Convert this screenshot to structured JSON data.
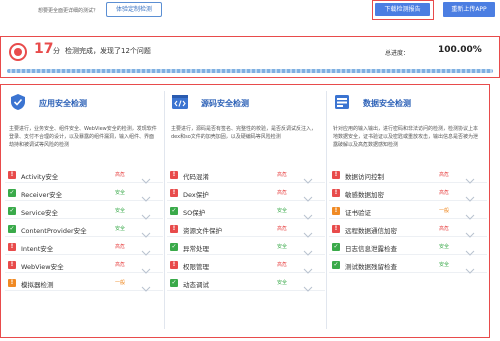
{
  "top": {
    "hint": "想要更全面更详细的测试？",
    "custom_btn": "体验定制检测",
    "download_btn": "下载检测报告",
    "reupload_btn": "重新上传APP"
  },
  "summary": {
    "score": "17",
    "score_unit": "分",
    "status": "检测完成，发现了12个问题",
    "progress_label": "总进度：",
    "progress_value": "100.00%",
    "progress_fraction": 1.0
  },
  "colors": {
    "accent": "#4b7ee2",
    "danger": "#e84b4b",
    "ok": "#3aaa4a",
    "warn": "#f08a24",
    "title": "#2f63b8"
  },
  "columns": [
    {
      "title": "应用安全检测",
      "icon": "shield-check-icon",
      "desc": "主要进行，业务安全、组件安全、WebView安全的检测，发现软件登录、支付不合理的设计，以及暴露的组件漏洞，输入组件、界面劫持和被调试等风险的检测",
      "items": [
        {
          "label": "Activity安全",
          "level": "高危",
          "status": "danger"
        },
        {
          "label": "Receiver安全",
          "level": "安全",
          "status": "ok"
        },
        {
          "label": "Service安全",
          "level": "安全",
          "status": "ok"
        },
        {
          "label": "ContentProvider安全",
          "level": "安全",
          "status": "ok"
        },
        {
          "label": "Intent安全",
          "level": "高危",
          "status": "danger"
        },
        {
          "label": "WebView安全",
          "level": "高危",
          "status": "danger"
        },
        {
          "label": "模拟器检测",
          "level": "一般",
          "status": "warn"
        }
      ]
    },
    {
      "title": "源码安全检测",
      "icon": "code-window-icon",
      "desc": "主要进行，源码是否有签名、完整性的校验，是否反调试反注入，dex和so文件的加壳加固，以及硬编码等风险检测",
      "items": [
        {
          "label": "代码混淆",
          "level": "高危",
          "status": "danger"
        },
        {
          "label": "Dex保护",
          "level": "高危",
          "status": "danger"
        },
        {
          "label": "SO保护",
          "level": "安全",
          "status": "ok"
        },
        {
          "label": "资源文件保护",
          "level": "高危",
          "status": "danger"
        },
        {
          "label": "异常处理",
          "level": "安全",
          "status": "ok"
        },
        {
          "label": "权限管理",
          "level": "高危",
          "status": "danger"
        },
        {
          "label": "动态调试",
          "level": "安全",
          "status": "ok"
        }
      ]
    },
    {
      "title": "数据安全检测",
      "icon": "database-lock-icon",
      "desc": "针对应用的输入输出，进行密码和非法访问的检测，检测协议上本地数据安全，证书验证以及密匙或重放攻击，输出信息是否被为泄露破解以及高危数据感知检测",
      "items": [
        {
          "label": "数据访问控制",
          "level": "高危",
          "status": "danger"
        },
        {
          "label": "敏感数据加密",
          "level": "高危",
          "status": "danger"
        },
        {
          "label": "证书验证",
          "level": "一般",
          "status": "warn"
        },
        {
          "label": "远程数据通信加密",
          "level": "高危",
          "status": "danger"
        },
        {
          "label": "日志信息泄露检查",
          "level": "安全",
          "status": "ok"
        },
        {
          "label": "测试数据残留检查",
          "level": "安全",
          "status": "ok"
        }
      ]
    }
  ]
}
